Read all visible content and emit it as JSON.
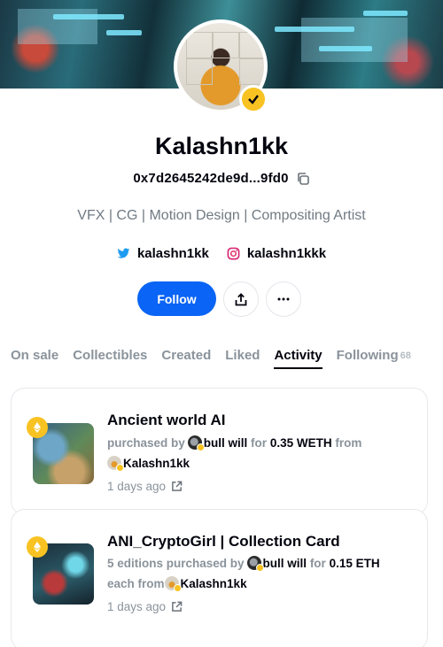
{
  "profile": {
    "name": "Kalashn1kk",
    "address": "0x7d2645242de9d...9fd0",
    "bio": "VFX | CG | Motion Design | Compositing Artist",
    "twitter": "kalashn1kk",
    "instagram": "kalashn1kkk"
  },
  "actions": {
    "follow_label": "Follow"
  },
  "tabs": [
    {
      "label": "On sale"
    },
    {
      "label": "Collectibles"
    },
    {
      "label": "Created"
    },
    {
      "label": "Liked"
    },
    {
      "label": "Activity",
      "active": true
    },
    {
      "label": "Following",
      "count": "68"
    }
  ],
  "activity": [
    {
      "title": "Ancient world AI",
      "purchase_prefix": "purchased by",
      "buyer": "bull will",
      "for_label": "for",
      "price": "0.35 WETH",
      "from_label": "from",
      "seller": "Kalashn1kk",
      "time": "1 days ago"
    },
    {
      "title": "ANI_CryptoGirl | Collection Card",
      "purchase_prefix": "5 editions purchased by",
      "buyer": "bull will",
      "for_label": "for",
      "price": "0.15 ETH",
      "from_label": "each from",
      "seller": "Kalashn1kk",
      "time": "1 days ago"
    }
  ],
  "colors": {
    "accent": "#0a64f5",
    "verified": "#f8c322",
    "muted": "#8a939b"
  }
}
